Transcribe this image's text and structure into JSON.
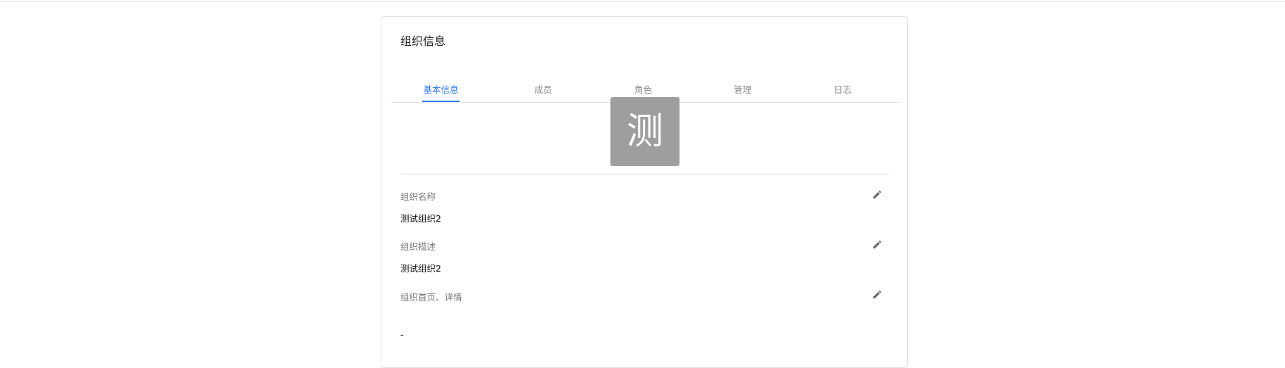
{
  "card": {
    "title": "组织信息"
  },
  "tabs": [
    {
      "label": "基本信息",
      "active": true
    },
    {
      "label": "成员",
      "active": false
    },
    {
      "label": "角色",
      "active": false
    },
    {
      "label": "管理",
      "active": false
    },
    {
      "label": "日志",
      "active": false
    }
  ],
  "avatar": {
    "char": "测",
    "bg_color": "#9e9e9e"
  },
  "fields": [
    {
      "label": "组织名称",
      "value": "测试组织2",
      "action_icon": "pencil-icon"
    },
    {
      "label": "组织描述",
      "value": "测试组织2",
      "action_icon": "pencil-icon"
    },
    {
      "label": "组织首页、详情",
      "value": "-",
      "action_icon": "pencil-icon"
    }
  ],
  "colors": {
    "accent": "#2d7be5",
    "tab_inactive": "#8d8d8d",
    "label": "#777777",
    "value": "#111111",
    "icon": "#6b6b6b"
  }
}
